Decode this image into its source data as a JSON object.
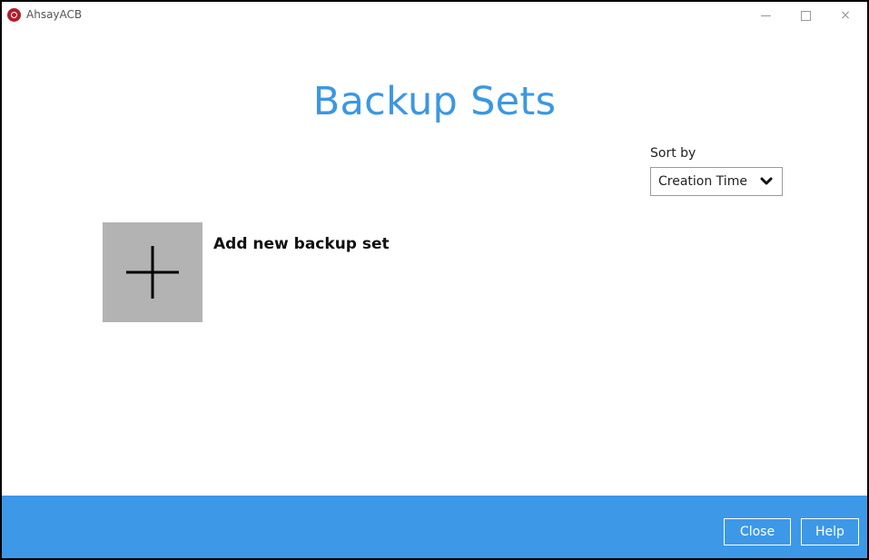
{
  "window": {
    "app_title": "AhsayACB",
    "minimize_glyph": "minimize-icon",
    "maximize_glyph": "maximize-icon",
    "close_glyph": "×"
  },
  "main": {
    "title": "Backup Sets",
    "sort": {
      "label": "Sort by",
      "selected": "Creation Time"
    },
    "add_backup_set": {
      "icon": "plus-icon",
      "label": "Add new backup set"
    }
  },
  "footer": {
    "close_label": "Close",
    "help_label": "Help"
  },
  "colors": {
    "accent": "#3b97e3",
    "footer_bg": "#3d98e8",
    "tile_bg": "#b3b3b3",
    "logo": "#b01e2b"
  }
}
